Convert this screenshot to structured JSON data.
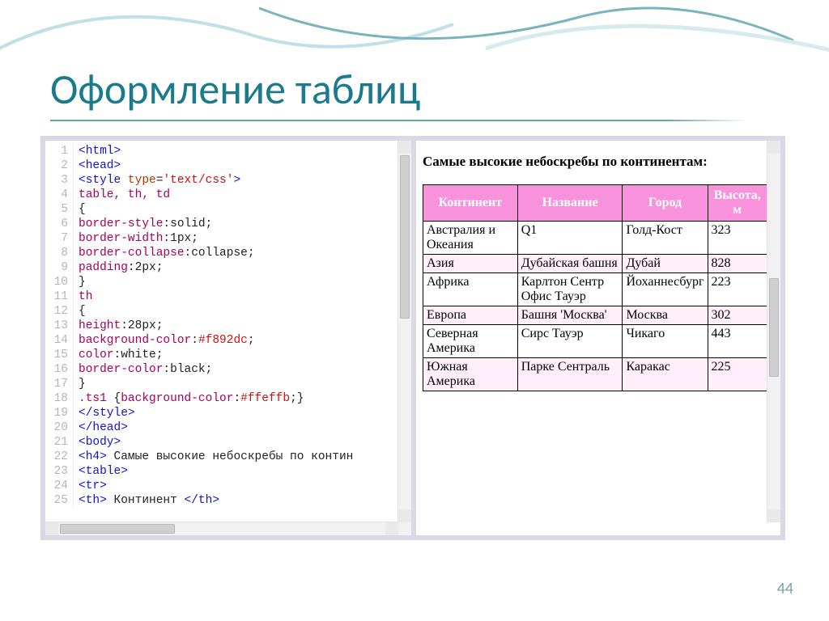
{
  "slide": {
    "title": "Оформление таблиц",
    "page_number": "44"
  },
  "preview": {
    "heading": "Самые высокие небоскребы по континентам:",
    "headers": [
      "Континент",
      "Название",
      "Город",
      "Высота, м"
    ],
    "rows": [
      {
        "striped": false,
        "cells": [
          "Австралия и Океания",
          "Q1",
          "Голд-Кост",
          "323"
        ]
      },
      {
        "striped": true,
        "cells": [
          "Азия",
          "Дубайская башня",
          "Дубай",
          "828"
        ]
      },
      {
        "striped": false,
        "cells": [
          "Африка",
          "Карлтон Сентр Офис Тауэр",
          "Йоханнесбург",
          "223"
        ]
      },
      {
        "striped": true,
        "cells": [
          "Европа",
          "Башня 'Москва'",
          "Москва",
          "302"
        ]
      },
      {
        "striped": false,
        "cells": [
          "Северная Америка",
          "Сирс Тауэр",
          "Чикаго",
          "443"
        ]
      },
      {
        "striped": true,
        "cells": [
          "Южная Америка",
          "Парке Сентраль",
          "Каракас",
          "225"
        ]
      }
    ]
  },
  "code": {
    "lines": [
      {
        "n": "1",
        "html": "<span class='tag'>&lt;html&gt;</span>"
      },
      {
        "n": "2",
        "html": "<span class='tag'>&lt;head&gt;</span>"
      },
      {
        "n": "3",
        "html": "<span class='tag'>&lt;style</span> <span class='attrn'>type</span>=<span class='str'>'text/css'</span><span class='tag'>&gt;</span>"
      },
      {
        "n": "4",
        "html": "<span class='sel'>table, th, td</span>"
      },
      {
        "n": "5",
        "html": "{"
      },
      {
        "n": "6",
        "html": "<span class='css-prop'>border-style</span>:solid;"
      },
      {
        "n": "7",
        "html": "<span class='css-prop'>border-width</span>:1px;"
      },
      {
        "n": "8",
        "html": "<span class='css-prop'>border-collapse</span>:collapse;"
      },
      {
        "n": "9",
        "html": "<span class='css-prop'>padding</span>:2px;"
      },
      {
        "n": "10",
        "html": "}"
      },
      {
        "n": "11",
        "html": "<span class='sel'>th</span>"
      },
      {
        "n": "12",
        "html": "{"
      },
      {
        "n": "13",
        "html": "<span class='css-prop'>height</span>:28px;"
      },
      {
        "n": "14",
        "html": "<span class='css-prop'>background-color</span>:<span class='hex'>#f892dc</span>;"
      },
      {
        "n": "15",
        "html": "<span class='css-prop'>color</span>:white;"
      },
      {
        "n": "16",
        "html": "<span class='css-prop'>border-color</span>:black;"
      },
      {
        "n": "17",
        "html": "}"
      },
      {
        "n": "18",
        "html": "<span class='sel'>.ts1</span> {<span class='css-prop'>background-color</span>:<span class='hex'>#ffeffb</span>;}"
      },
      {
        "n": "19",
        "html": "<span class='tag'>&lt;/style&gt;</span>"
      },
      {
        "n": "20",
        "html": "<span class='tag'>&lt;/head&gt;</span>"
      },
      {
        "n": "21",
        "html": "<span class='tag'>&lt;body&gt;</span>"
      },
      {
        "n": "22",
        "html": "<span class='tag'>&lt;h4&gt;</span> Самые высокие небоскребы по контин"
      },
      {
        "n": "23",
        "html": "<span class='tag'>&lt;table&gt;</span>"
      },
      {
        "n": "24",
        "html": "<span class='tag'>&lt;tr&gt;</span>"
      },
      {
        "n": "25",
        "html": "<span class='tag'>&lt;th&gt;</span> Континент <span class='tag'>&lt;/th&gt;</span>"
      }
    ]
  },
  "chart_data": {
    "type": "table",
    "title": "Самые высокие небоскребы по континентам:",
    "columns": [
      "Континент",
      "Название",
      "Город",
      "Высота, м"
    ],
    "rows": [
      [
        "Австралия и Океания",
        "Q1",
        "Голд-Кост",
        323
      ],
      [
        "Азия",
        "Дубайская башня",
        "Дубай",
        828
      ],
      [
        "Африка",
        "Карлтон Сентр Офис Тауэр",
        "Йоханнесбург",
        223
      ],
      [
        "Европа",
        "Башня 'Москва'",
        "Москва",
        302
      ],
      [
        "Северная Америка",
        "Сирс Тауэр",
        "Чикаго",
        443
      ],
      [
        "Южная Америка",
        "Парке Сентраль",
        "Каракас",
        225
      ]
    ]
  }
}
